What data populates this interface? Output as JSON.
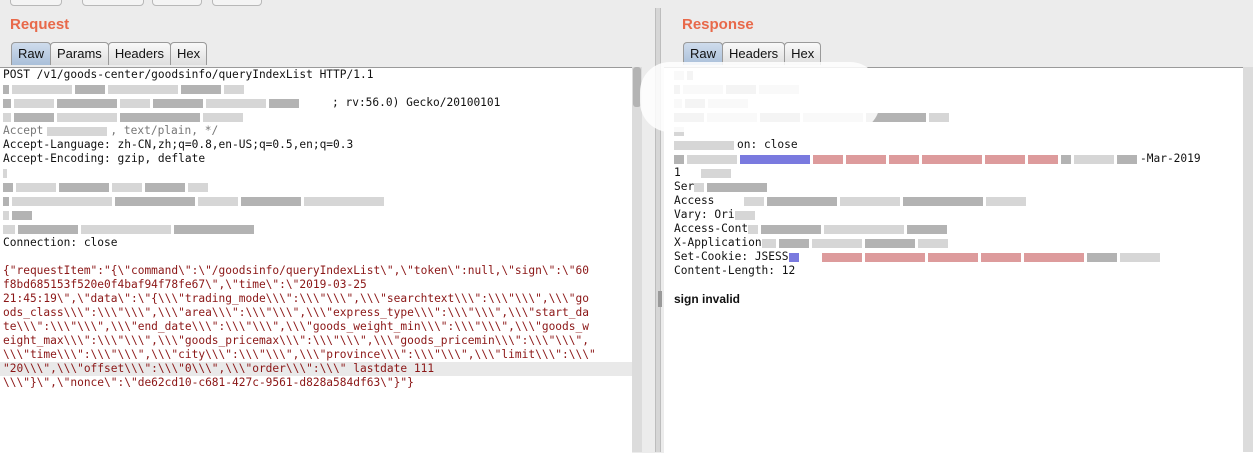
{
  "request": {
    "title": "Request",
    "tabs": [
      "Raw",
      "Params",
      "Headers",
      "Hex"
    ],
    "active_tab": "Raw",
    "lines": {
      "request_line": "POST /v1/goods-center/goodsinfo/queryIndexList HTTP/1.1",
      "ua_tail": "; rv:56.0) Gecko/20100101",
      "accept_tail": ", text/plain, */",
      "accept_prefix": "Accept",
      "accept_language": "Accept-Language: zh-CN,zh;q=0.8,en-US;q=0.5,en;q=0.3",
      "accept_encoding": "Accept-Encoding: gzip, deflate",
      "connection": "Connection: close"
    },
    "body_lines": [
      "{\"requestItem\":\"{\\\"command\\\":\\\"/goodsinfo/queryIndexList\\\",\\\"token\\\":null,\\\"sign\\\":\\\"60",
      "f8bd685153f520e0f4baf94f78fe67\\\",\\\"time\\\":\\\"2019-03-25",
      "21:45:19\\\",\\\"data\\\":\\\"{\\\\\\\"trading_mode\\\\\\\":\\\\\\\"\\\\\\\",\\\\\\\"searchtext\\\\\\\":\\\\\\\"\\\\\\\",\\\\\\\"go",
      "ods_class\\\\\\\":\\\\\\\"\\\\\\\",\\\\\\\"area\\\\\\\":\\\\\\\"\\\\\\\",\\\\\\\"express_type\\\\\\\":\\\\\\\"\\\\\\\",\\\\\\\"start_da",
      "te\\\\\\\":\\\\\\\"\\\\\\\",\\\\\\\"end_date\\\\\\\":\\\\\\\"\\\\\\\",\\\\\\\"goods_weight_min\\\\\\\":\\\\\\\"\\\\\\\",\\\\\\\"goods_w",
      "eight_max\\\\\\\":\\\\\\\"\\\\\\\",\\\\\\\"goods_pricemax\\\\\\\":\\\\\\\"\\\\\\\",\\\\\\\"goods_pricemin\\\\\\\":\\\\\\\"\\\\\\\",",
      "\\\\\\\"time\\\\\\\":\\\\\\\"\\\\\\\",\\\\\\\"city\\\\\\\":\\\\\\\"\\\\\\\",\\\\\\\"province\\\\\\\":\\\\\\\"\\\\\\\",\\\\\\\"limit\\\\\\\":\\\\\\\"",
      "\"20\\\\\\\",\\\\\\\"offset\\\\\\\":\\\\\\\"0\\\\\\\",\\\\\\\"order\\\\\\\":\\\\\\\" lastdate 111",
      "\\\\\\\"}\\\",\\\"nonce\\\":\\\"de62cd10-c681-427c-9561-d828a584df63\\\"}\"}"
    ]
  },
  "response": {
    "title": "Response",
    "tabs": [
      "Raw",
      "Headers",
      "Hex"
    ],
    "active_tab": "Raw",
    "lines": {
      "connection_tail": "on: close",
      "date_tail": "-Mar-2019",
      "l1": "1",
      "server": "Ser",
      "access1": "Access",
      "vary": "Vary: Ori",
      "access2": "Access-Cont",
      "app": "X-Application",
      "cookie": "Set-Cookie: JSESS",
      "content_length": "Content-Length: 12"
    },
    "body": "sign invalid"
  }
}
